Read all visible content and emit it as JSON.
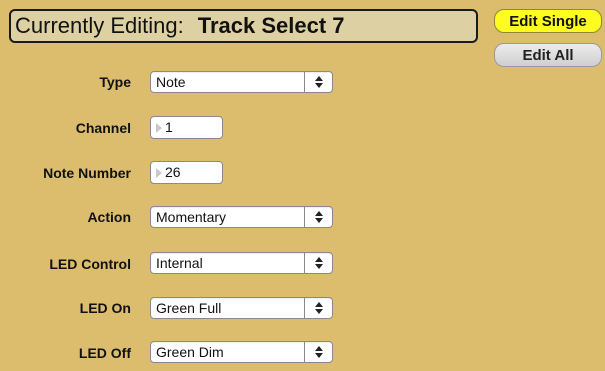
{
  "header": {
    "prefix": "Currently Editing:",
    "name": "Track Select 7"
  },
  "mode": {
    "edit_single": "Edit Single",
    "edit_all": "Edit All",
    "active": "Edit Single",
    "active_color": "#fdfb1f"
  },
  "fields": {
    "type": {
      "label": "Type",
      "value": "Note"
    },
    "channel": {
      "label": "Channel",
      "value": "1"
    },
    "note_number": {
      "label": "Note Number",
      "value": "26"
    },
    "action": {
      "label": "Action",
      "value": "Momentary"
    },
    "led_control": {
      "label": "LED Control",
      "value": "Internal"
    },
    "led_on": {
      "label": "LED On",
      "value": "Green Full"
    },
    "led_off": {
      "label": "LED Off",
      "value": "Green Dim"
    }
  },
  "colors": {
    "panel_background": "#dcbd6e",
    "header_background": "#ddd1a3"
  },
  "icons": {
    "select_arrows": "up-down-chevron-icon",
    "stepper_grip": "triangle-right-icon"
  }
}
